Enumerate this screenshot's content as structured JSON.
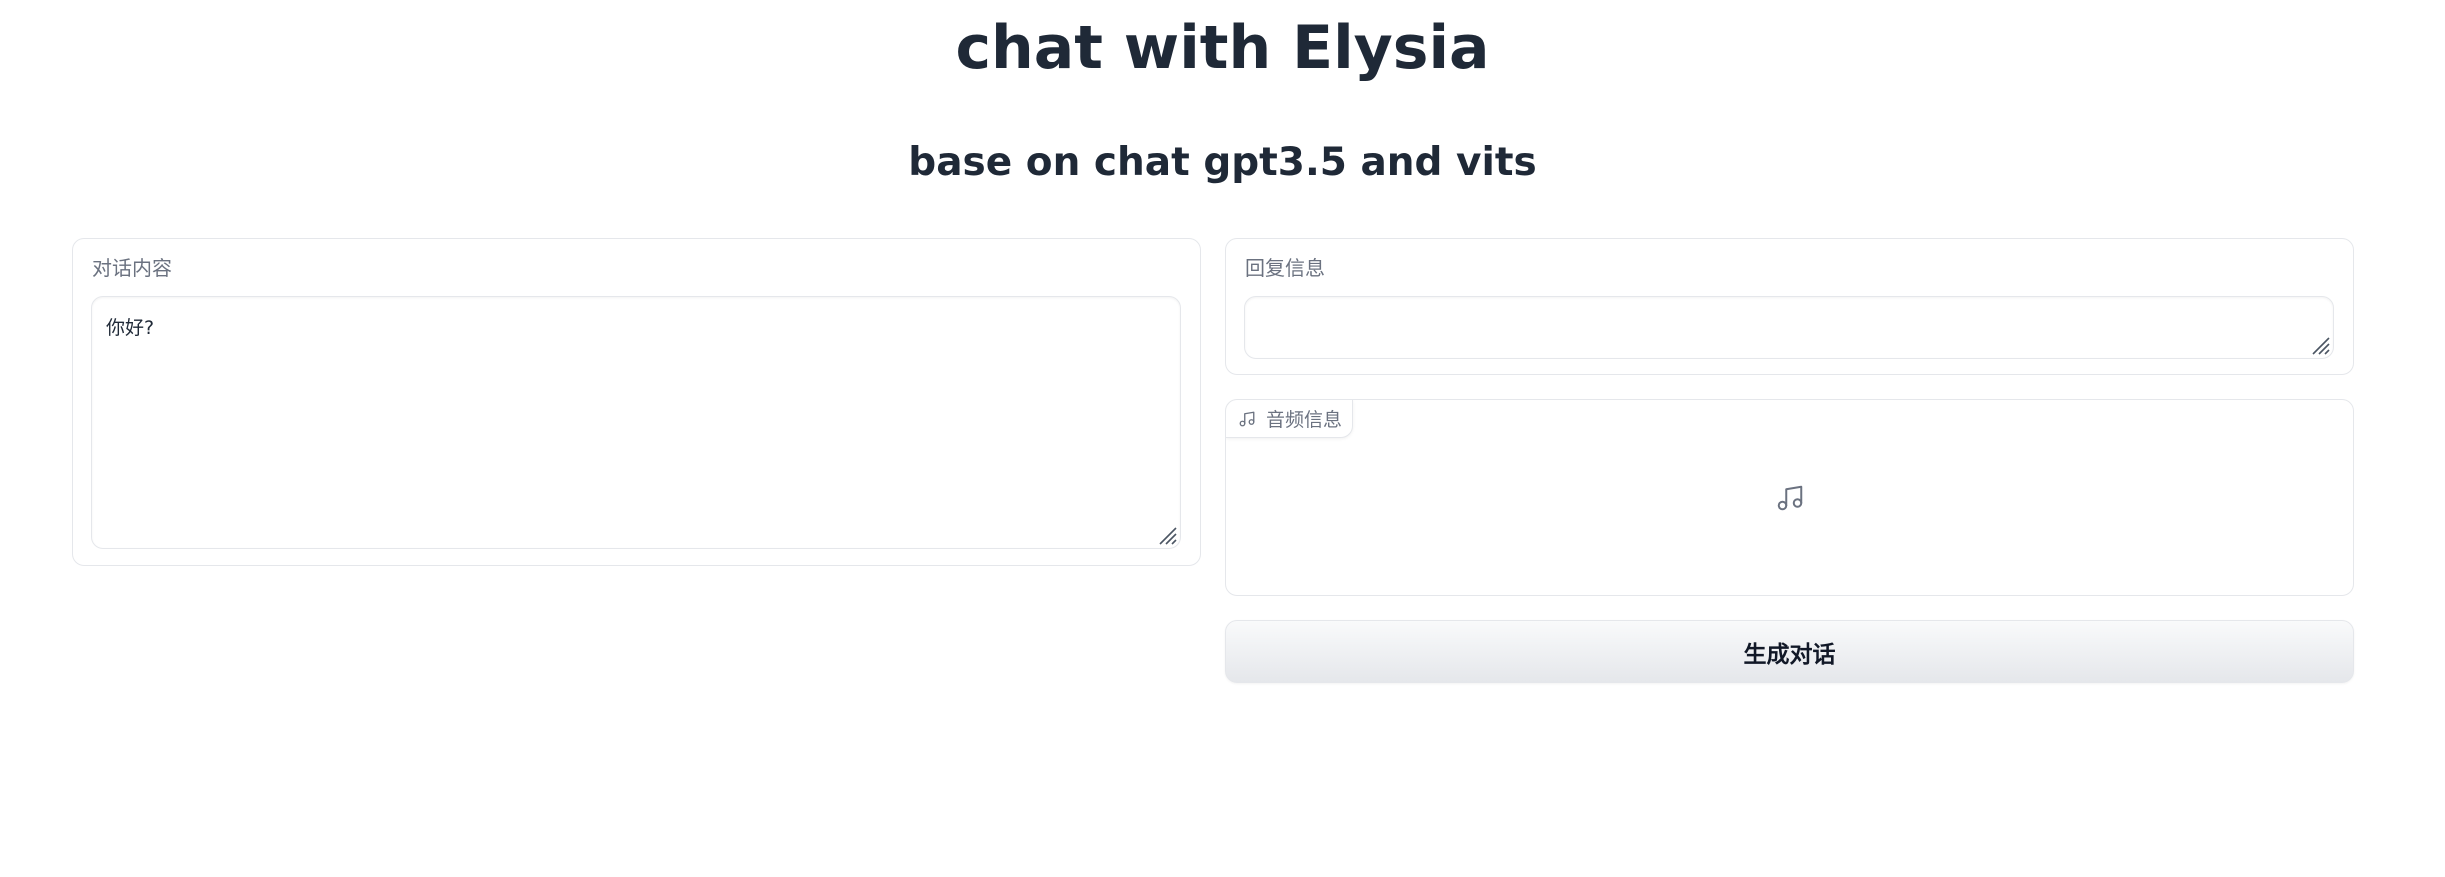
{
  "header": {
    "title": "chat with Elysia",
    "subtitle": "base on chat gpt3.5 and vits"
  },
  "input_panel": {
    "label": "对话内容",
    "value": "你好?"
  },
  "reply_panel": {
    "label": "回复信息",
    "value": ""
  },
  "audio_panel": {
    "label": "音频信息",
    "icon": "music-note-icon"
  },
  "actions": {
    "generate_label": "生成对话"
  },
  "colors": {
    "border": "#e5e7eb",
    "label": "#6b7280",
    "text": "#1f2937"
  }
}
